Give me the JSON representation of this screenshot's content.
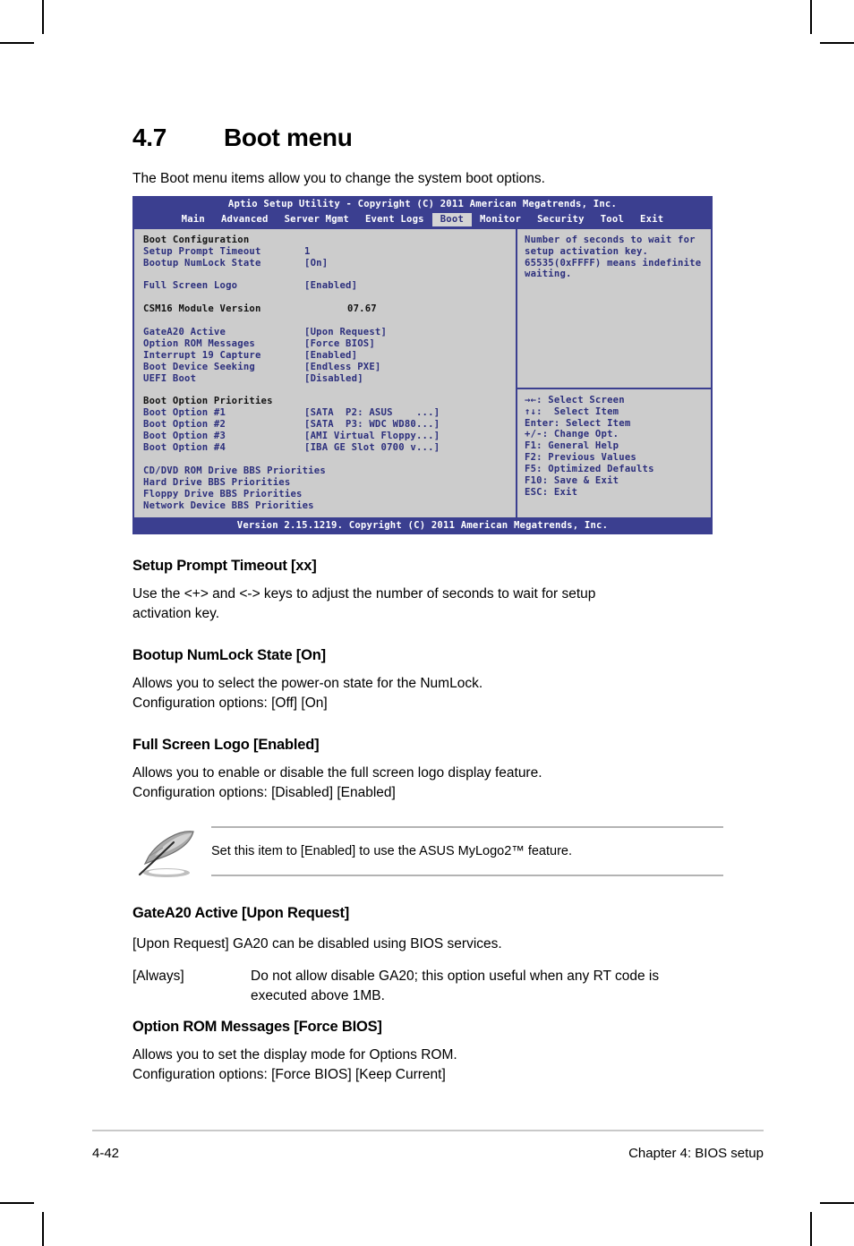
{
  "document": {
    "section_number": "4.7",
    "section_title": "Boot menu",
    "intro": "The Boot menu items allow you to change the system boot options."
  },
  "bios": {
    "title": "Aptio Setup Utility - Copyright (C) 2011 American Megatrends, Inc.",
    "menu_tabs": [
      {
        "label": "Main",
        "active": false
      },
      {
        "label": "Advanced",
        "active": false
      },
      {
        "label": "Server Mgmt",
        "active": false
      },
      {
        "label": "Event Logs",
        "active": false
      },
      {
        "label": "Boot",
        "active": true
      },
      {
        "label": "Monitor",
        "active": false
      },
      {
        "label": "Security",
        "active": false
      },
      {
        "label": "Tool",
        "active": false
      },
      {
        "label": "Exit",
        "active": false
      }
    ],
    "groups": [
      {
        "heading": "Boot Configuration",
        "items": [
          {
            "label": "Setup Prompt Timeout",
            "value": "1"
          },
          {
            "label": "Bootup NumLock State",
            "value": "[On]"
          }
        ]
      },
      {
        "items": [
          {
            "label": "Full Screen Logo",
            "value": "[Enabled]"
          }
        ]
      },
      {
        "readonly": [
          {
            "label": "CSM16 Module Version",
            "value": "07.67"
          }
        ]
      },
      {
        "items": [
          {
            "label": "GateA20 Active",
            "value": "[Upon Request]"
          },
          {
            "label": "Option ROM Messages",
            "value": "[Force BIOS]"
          },
          {
            "label": "Interrupt 19 Capture",
            "value": "[Enabled]"
          },
          {
            "label": "Boot Device Seeking",
            "value": "[Endless PXE]"
          },
          {
            "label": "UEFI Boot",
            "value": "[Disabled]"
          }
        ]
      },
      {
        "heading": "Boot Option Priorities",
        "items": [
          {
            "label": "Boot Option #1",
            "value": "[SATA  P2: ASUS    ...]"
          },
          {
            "label": "Boot Option #2",
            "value": "[SATA  P3: WDC WD80...]"
          },
          {
            "label": "Boot Option #3",
            "value": "[AMI Virtual Floppy...]"
          },
          {
            "label": "Boot Option #4",
            "value": "[IBA GE Slot 0700 v...]"
          }
        ]
      },
      {
        "links": [
          "CD/DVD ROM Drive BBS Priorities",
          "Hard Drive BBS Priorities",
          "Floppy Drive BBS Priorities",
          "Network Device BBS Priorities"
        ]
      }
    ],
    "help_lines": [
      "Number of seconds to wait for",
      "setup activation key.",
      "65535(0xFFFF) means indefinite",
      "waiting."
    ],
    "key_legend": [
      "→←: Select Screen",
      "↑↓:  Select Item",
      "Enter: Select Item",
      "+/-: Change Opt.",
      "F1: General Help",
      "F2: Previous Values",
      "F5: Optimized Defaults",
      "F10: Save & Exit",
      "ESC: Exit"
    ],
    "footer": "Version 2.15.1219. Copyright (C) 2011 American Megatrends, Inc.",
    "colors": {
      "header_blue": "#3b3f90",
      "panel_gray": "#cccccc",
      "label_blue": "#2c2f7d",
      "active_tab_bg": "#d4d4d4"
    }
  },
  "items": {
    "setup_prompt_timeout": {
      "heading": "Setup Prompt Timeout [xx]",
      "line1": "Use the <+> and <-> keys to adjust the number of seconds to wait for setup",
      "line2": "activation key."
    },
    "bootup_numlock": {
      "heading": "Bootup NumLock State [On]",
      "line1": "Allows you to select the power-on state for the NumLock.",
      "line2": "Configuration options: [Off] [On]"
    },
    "full_screen_logo": {
      "heading": "Full Screen Logo [Enabled]",
      "line1": "Allows you to enable or disable the full screen logo display feature.",
      "line2": "Configuration options: [Disabled] [Enabled]",
      "note": "Set this item to [Enabled] to use the ASUS MyLogo2™ feature."
    },
    "gatea20": {
      "heading": "GateA20 Active [Upon Request]",
      "line1": "[Upon Request] GA20 can be disabled using BIOS services.",
      "term": "[Always]",
      "desc_line1": "Do not allow disable GA20; this option useful when any RT code is",
      "desc_line2": "executed above 1MB."
    },
    "option_rom": {
      "heading": "Option ROM Messages [Force BIOS]",
      "line1": "Allows you to set the display mode for Options ROM.",
      "line2": "Configuration options: [Force BIOS] [Keep Current]"
    }
  },
  "page_footer": {
    "page_number": "4-42",
    "chapter": "Chapter 4: BIOS setup"
  }
}
